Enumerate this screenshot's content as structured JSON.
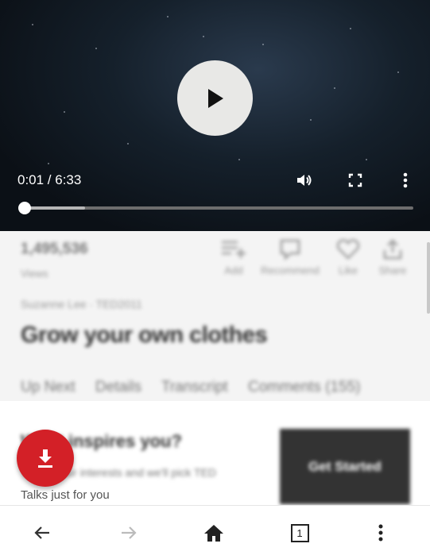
{
  "player": {
    "time_display": "0:01 / 6:33",
    "progress_fraction": 0.0015,
    "buffered_fraction": 0.16
  },
  "stats": {
    "views_count": "1,495,536",
    "views_label": "Views",
    "actions": [
      {
        "label": "Add",
        "icon": "playlist-add-icon"
      },
      {
        "label": "Recommend",
        "icon": "recommend-icon"
      },
      {
        "label": "Like",
        "icon": "heart-icon"
      },
      {
        "label": "Share",
        "icon": "share-icon"
      }
    ]
  },
  "talk": {
    "speaker": "Suzanne Lee · TED2011",
    "title": "Grow your own clothes"
  },
  "tabs": [
    "Up Next",
    "Details",
    "Transcript",
    "Comments (155)"
  ],
  "promo": {
    "title": "What inspires you?",
    "desc": "Tell us your interests and we'll pick TED",
    "desc2": "Talks just for you",
    "button": "Get Started"
  },
  "browser_nav": {
    "tab_count": "1"
  },
  "colors": {
    "fab": "#d32027",
    "video_bg": "#0b1016"
  }
}
